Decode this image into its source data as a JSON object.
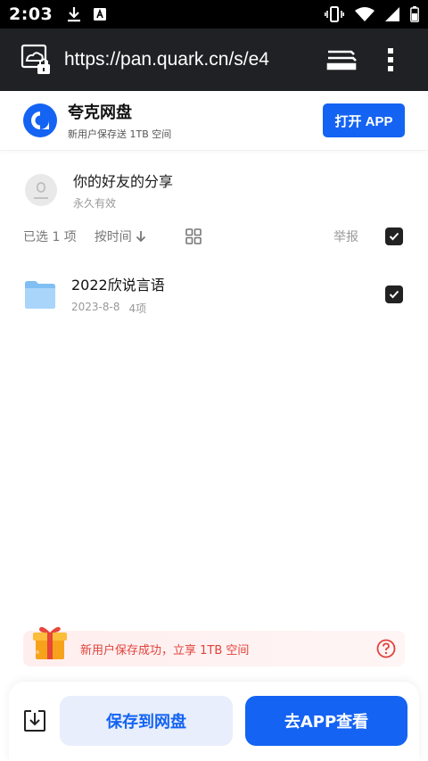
{
  "status_bar": {
    "time": "2:03"
  },
  "url_bar": {
    "url": "https://pan.quark.cn/s/e4"
  },
  "app_banner": {
    "name": "夸克网盘",
    "subtitle": "新用户保存送 1TB 空间",
    "open_button": "打开 APP"
  },
  "share": {
    "title": "你的好友的分享",
    "validity": "永久有效"
  },
  "toolbar": {
    "selected": "已选 1 项",
    "sort_label": "按时间",
    "report": "举报"
  },
  "files": [
    {
      "name": "2022欣说言语",
      "date": "2023-8-8",
      "count": "4项",
      "checked": true
    }
  ],
  "promo": {
    "text": "新用户保存成功，立享 1TB 空间"
  },
  "bottom_bar": {
    "save_button": "保存到网盘",
    "goto_app_button": "去APP查看"
  },
  "colors": {
    "brand_blue": "#1463f3",
    "promo_red": "#e0433b",
    "url_bar_bg": "#202124"
  }
}
